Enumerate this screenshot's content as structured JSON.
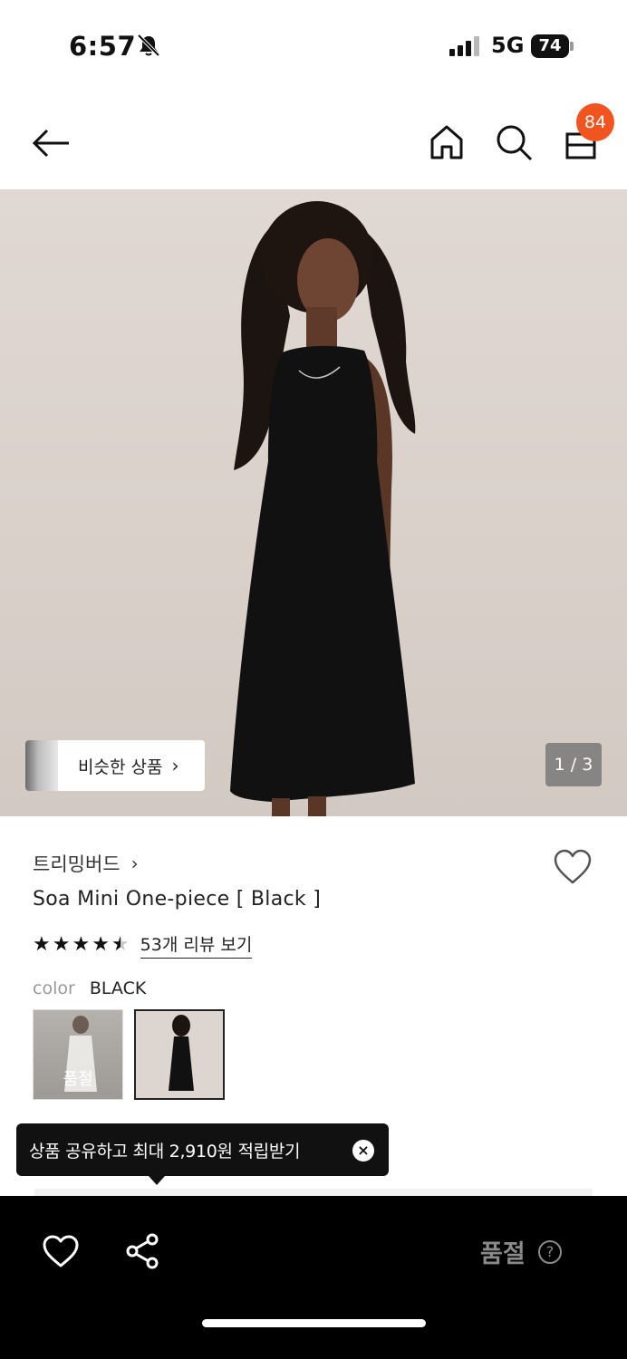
{
  "status_bar": {
    "time": "6:57",
    "network": "5G",
    "battery": "74"
  },
  "header": {
    "back_icon": "arrow-left-icon",
    "home_icon": "home-icon",
    "search_icon": "search-icon",
    "cart_icon": "shopping-bag-icon",
    "cart_count": "84",
    "badge_color": "#f1541f"
  },
  "hero": {
    "similar_products_label": "비슷한 상품",
    "similar_chevron": "›",
    "page_indicator": "1 / 3"
  },
  "product": {
    "brand": "트리밍버드",
    "brand_chevron": "›",
    "title": "Soa Mini One-piece [ Black ]",
    "rating_stars": 4.5,
    "reviews_label": "53개 리뷰 보기",
    "color_label": "color",
    "color_value": "BLACK",
    "swatches": [
      {
        "name": "white",
        "status": "품절"
      },
      {
        "name": "black",
        "selected": true
      }
    ]
  },
  "tooltip": {
    "text": "상품 공유하고 최대 2,910원 적립받기",
    "close": "×"
  },
  "bottom_bar": {
    "wishlist_icon": "heart-icon",
    "share_icon": "share-icon",
    "soldout_label": "품절",
    "help": "?"
  }
}
